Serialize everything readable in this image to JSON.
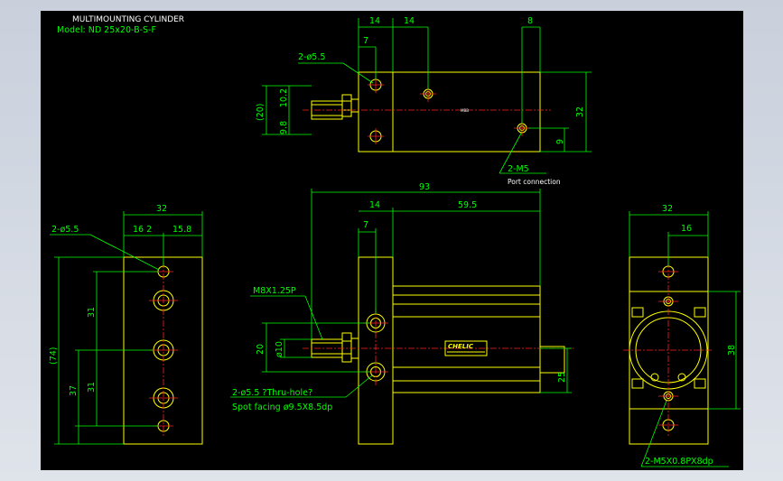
{
  "title": {
    "line1": "MULTIMOUNTING CYLINDER",
    "line2": "Model: ND 25x20-B-S-F"
  },
  "top_view": {
    "dims": {
      "d14a": "14",
      "d14b": "14",
      "d8": "8",
      "d7": "7",
      "d32": "32",
      "d9": "9",
      "d20": "(20)",
      "d10_2": "10.2",
      "d9_8": "9.8"
    },
    "callouts": {
      "holes": "2-ø5.5",
      "ports": "2-M5",
      "port_note": "Port connection"
    }
  },
  "front_view": {
    "dims": {
      "d93": "93",
      "d14": "14",
      "d59_5": "59.5",
      "d7": "7",
      "d20": "20",
      "d10": "ø10",
      "d25": "25"
    },
    "callouts": {
      "rod_thread": "M8X1.25P",
      "holes": "2-ø5.5 ?Thru-hole?",
      "spot": "Spot facing  ø9.5X8.5dp"
    },
    "label": "CHELIC"
  },
  "left_view": {
    "dims": {
      "d32": "32",
      "d16_2": "16 2",
      "d15_8": "15.8",
      "d74": "(74)",
      "d31a": "31",
      "d31b": "31",
      "d37": "37"
    },
    "callouts": {
      "holes": "2-ø5.5"
    }
  },
  "right_view": {
    "dims": {
      "d32": "32",
      "d16": "16",
      "d38": "38"
    },
    "callouts": {
      "thread": "2-M5X0.8PX8dp"
    }
  },
  "colors": {
    "background": "#000000",
    "outline": "#ffff00",
    "dimension": "#00ff00",
    "centerline": "#ff2020",
    "text": "#ffffff"
  }
}
